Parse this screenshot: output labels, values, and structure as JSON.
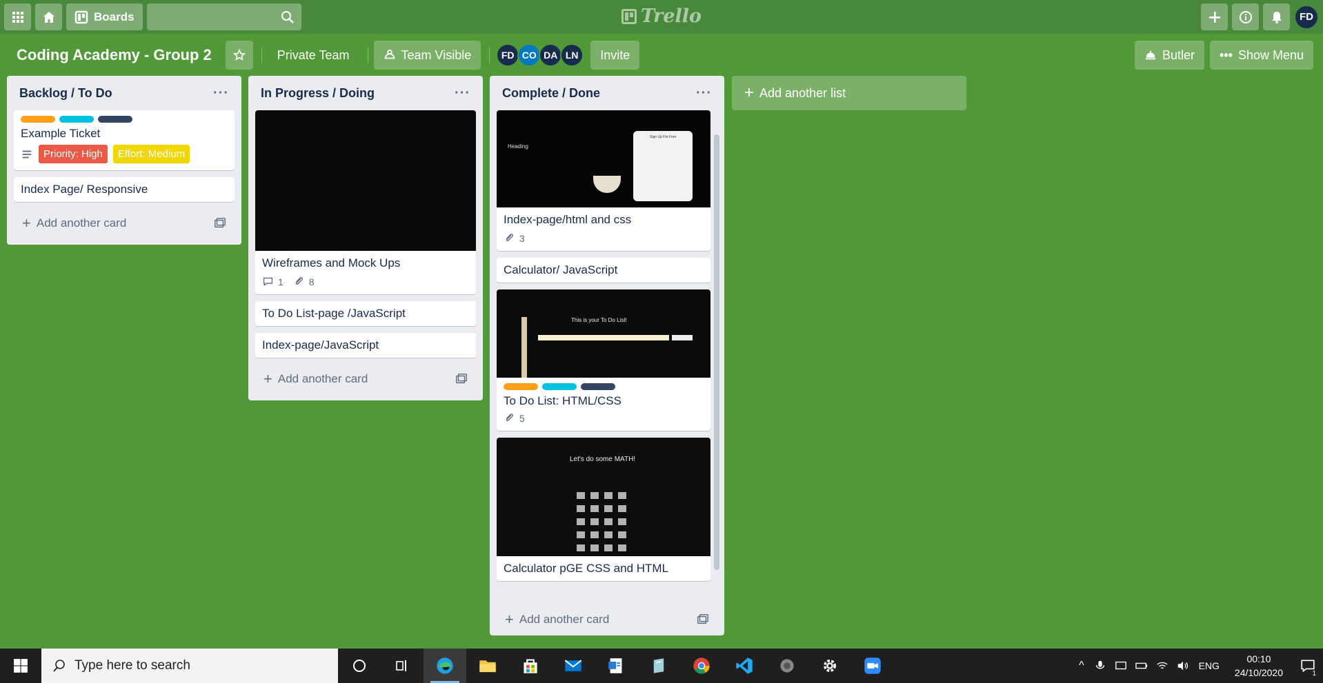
{
  "topbar": {
    "boards_label": "Boards",
    "logo_text": "Trello",
    "user_initials": "FD"
  },
  "board": {
    "title": "Coding Academy - Group 2",
    "team_label": "Private Team",
    "visibility_label": "Team Visible",
    "members": [
      "FD",
      "CO",
      "DA",
      "LN"
    ],
    "invite_label": "Invite",
    "butler_label": "Butler",
    "menu_label": "Show Menu"
  },
  "lists": [
    {
      "title": "Backlog / To Do",
      "cards": [
        {
          "title": "Example Ticket",
          "label1": "Priority: High",
          "label2": "Effort: Medium"
        },
        {
          "title": "Index Page/ Responsive"
        }
      ],
      "add_card": "Add another card"
    },
    {
      "title": "In Progress / Doing",
      "cards": [
        {
          "title": "Wireframes and Mock Ups",
          "comments": "1",
          "attachments": "8"
        },
        {
          "title": "To Do List-page /JavaScript"
        },
        {
          "title": "Index-page/JavaScript"
        }
      ],
      "add_card": "Add another card"
    },
    {
      "title": "Complete / Done",
      "cards": [
        {
          "title": "Index-page/html and css",
          "attachments": "3",
          "thumb_heading": "Heading",
          "thumb_form": "Sign Up For Free"
        },
        {
          "title": "Calculator/ JavaScript"
        },
        {
          "title": "To Do List: HTML/CSS",
          "attachments": "5",
          "thumb_text": "This is your To Do List!"
        },
        {
          "title": "Calculator pGE CSS and HTML",
          "thumb_text": "Let's do some MATH!"
        }
      ],
      "add_card": "Add another card"
    }
  ],
  "add_list": "Add another list",
  "label_colors": {
    "orange": "#ff9f1a",
    "sky": "#00c2e0",
    "black": "#344563",
    "red": "#eb5a46",
    "yellow": "#f2d600"
  },
  "taskbar": {
    "search_placeholder": "Type here to search",
    "lang": "ENG",
    "time": "00:10",
    "date": "24/10/2020",
    "notif_count": "1"
  }
}
